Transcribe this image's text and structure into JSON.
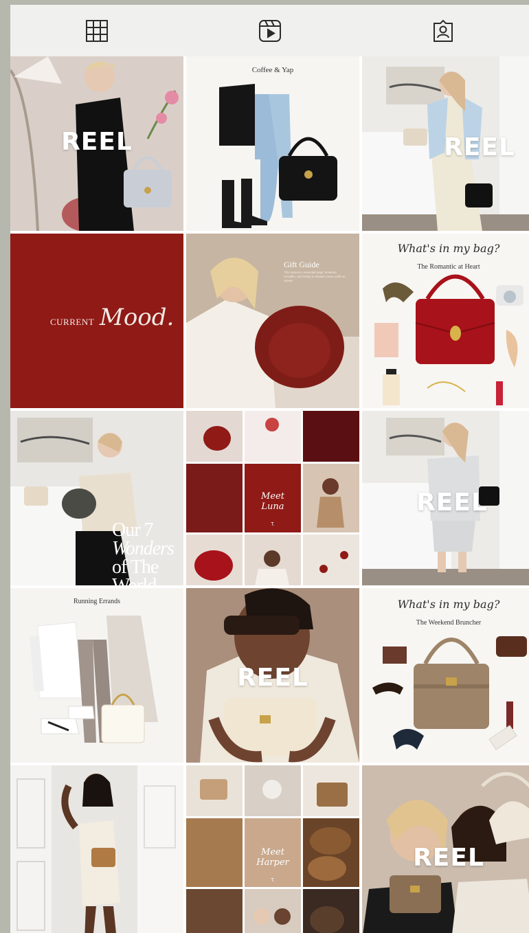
{
  "tabs": [
    {
      "icon": "grid-icon"
    },
    {
      "icon": "reels-icon"
    },
    {
      "icon": "tagged-icon"
    }
  ],
  "posts": {
    "p1": {
      "badge": "REEL"
    },
    "p2": {
      "title": "Coffee & Yap"
    },
    "p3": {
      "badge": "REEL"
    },
    "p4": {
      "word1": "CURRENT",
      "word2": "Mood."
    },
    "p5": {
      "title": "Gift Guide",
      "body": "This season's essential bags: timeless, versatile, and ready to elevate every outfit on repeat."
    },
    "p6": {
      "script": "What's in my bag?",
      "title": "The Romantic at Heart"
    },
    "p7": {
      "line1": "Our 7",
      "line2": "Wonders",
      "line3": "of The",
      "line4": "World"
    },
    "p8": {
      "line1": "Meet",
      "line2": "Luna",
      "mark": "T."
    },
    "p9": {
      "badge": "REEL"
    },
    "p10": {
      "title": "Running Errands"
    },
    "p11": {
      "badge": "REEL"
    },
    "p12": {
      "script": "What's in my bag?",
      "title": "The Weekend Bruncher"
    },
    "p14": {
      "line1": "Meet",
      "line2": "Harper",
      "mark": "T."
    },
    "p15": {
      "badge": "REEL"
    }
  },
  "colors": {
    "brand_red": "#8f1a16",
    "tan": "#8b6f55",
    "background": "#b6b7ad",
    "tab_bar": "#f0f0ee"
  }
}
